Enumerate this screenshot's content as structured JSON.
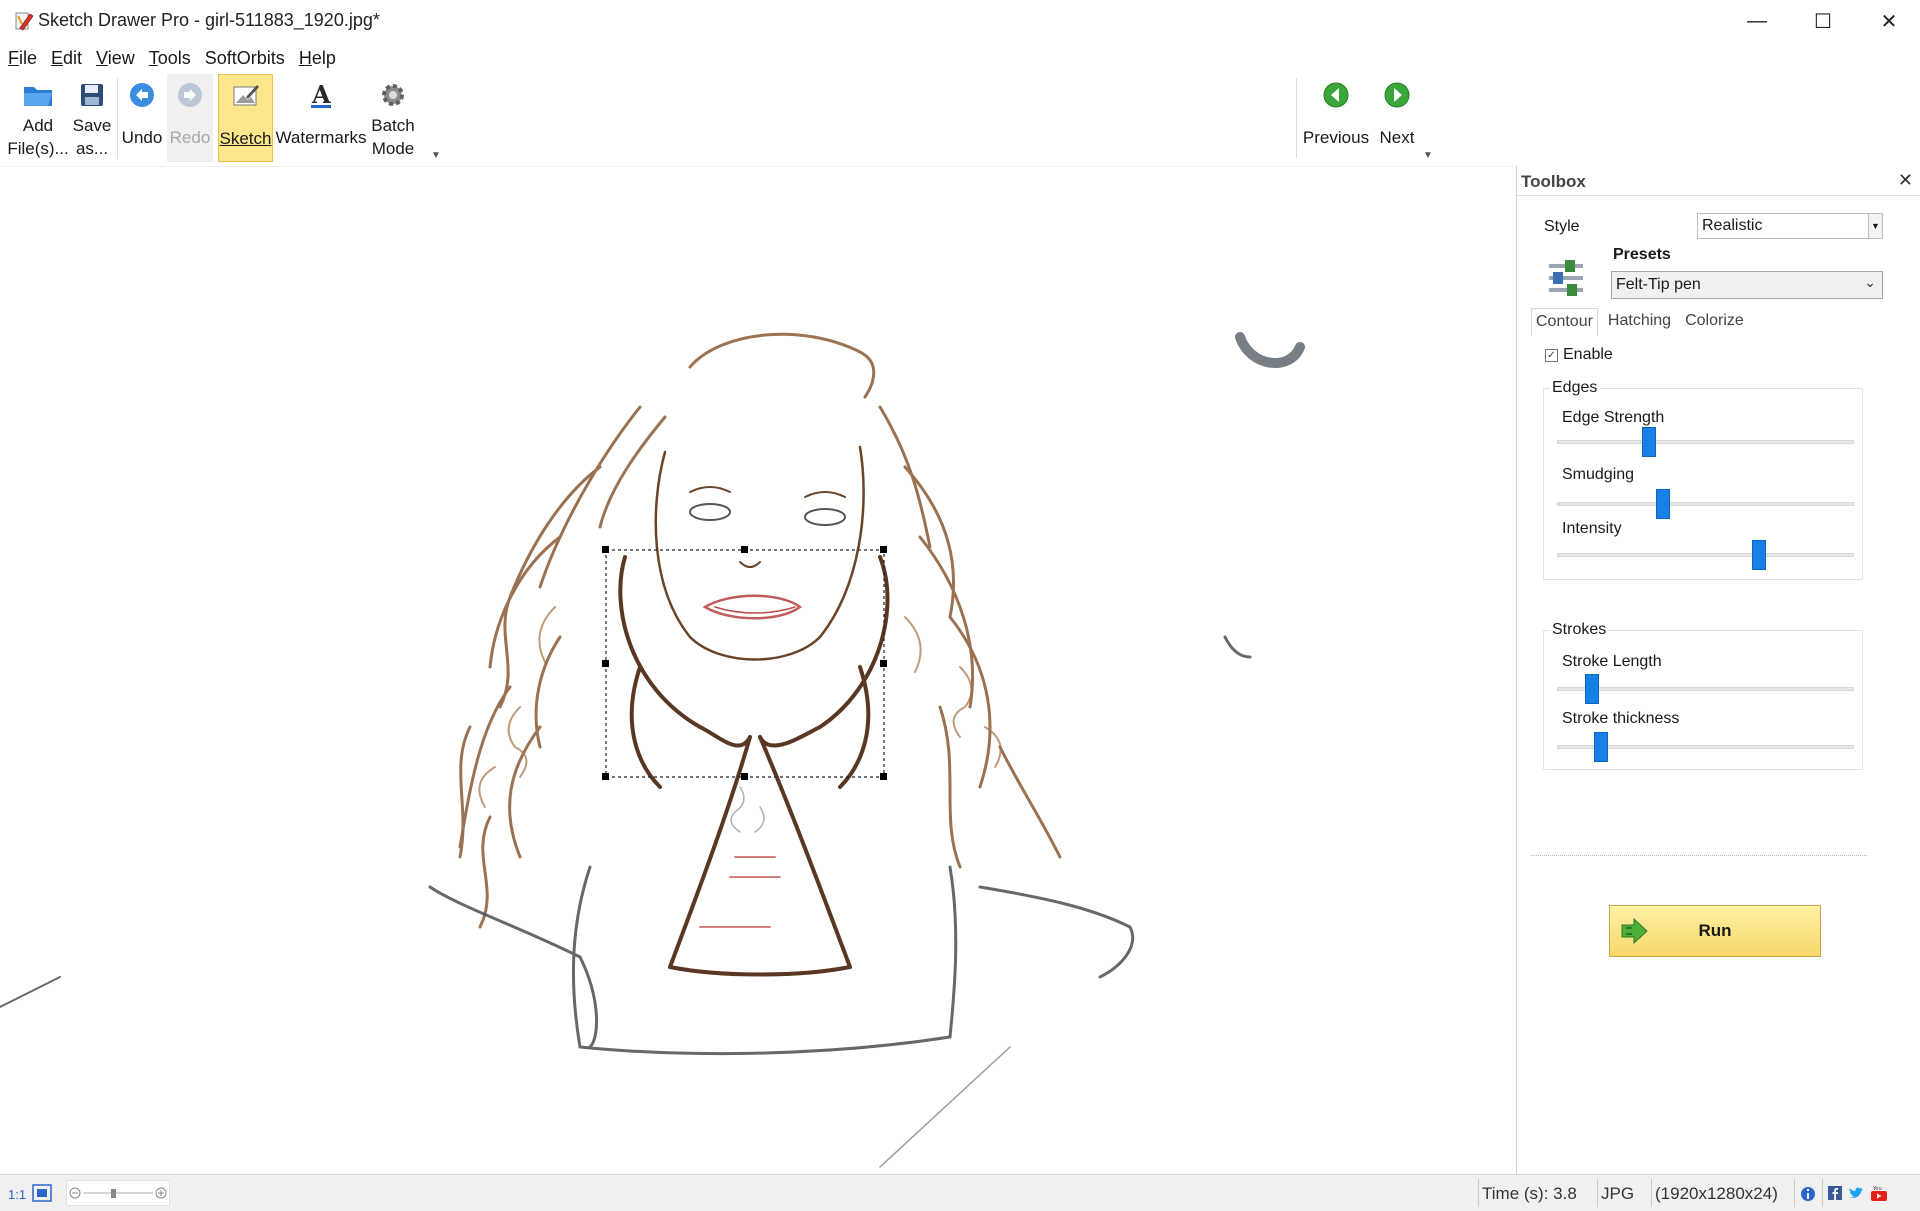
{
  "window": {
    "title": "Sketch Drawer Pro - girl-511883_1920.jpg*",
    "minimize_label": "—",
    "maximize_label": "☐",
    "close_label": "✕",
    "icon": "app-pencil-icon"
  },
  "menu": {
    "items": [
      {
        "u": "F",
        "rest": "ile"
      },
      {
        "u": "E",
        "rest": "dit"
      },
      {
        "u": "V",
        "rest": "iew"
      },
      {
        "u": "T",
        "rest": "ools"
      },
      {
        "u": "",
        "rest": "SoftOrbits"
      },
      {
        "u": "H",
        "rest": "elp"
      }
    ]
  },
  "toolbar": {
    "add_line1": "Add",
    "add_line2": "File(s)...",
    "save_line1": "Save",
    "save_line2": "as...",
    "undo": "Undo",
    "redo": "Redo",
    "sketch": "Sketch",
    "watermarks": "Watermarks",
    "batch_line1": "Batch",
    "batch_line2": "Mode",
    "previous": "Previous",
    "next": "Next",
    "accent_active": "#fde68c",
    "nav_green": "#3aa63a"
  },
  "toolbox": {
    "title": "Toolbox",
    "close_label": "✕",
    "style_label": "Style",
    "style_value": "Realistic",
    "presets_title": "Presets",
    "presets_value": "Felt-Tip pen",
    "tabs": [
      "Contour",
      "Hatching",
      "Colorize"
    ],
    "active_tab": "Contour",
    "enable_label": "Enable",
    "enable_checked": true,
    "edges_group": "Edges",
    "edge_strength_label": "Edge Strength",
    "edge_strength": 0.3,
    "smudging_label": "Smudging",
    "smudging": 0.35,
    "intensity_label": "Intensity",
    "intensity": 0.69,
    "strokes_group": "Strokes",
    "stroke_length_label": "Stroke Length",
    "stroke_length": 0.1,
    "stroke_thickness_label": "Stroke thickness",
    "stroke_thickness": 0.13,
    "run_label": "Run",
    "slider_color": "#1680e6"
  },
  "status": {
    "zoom_1to1": "1:1",
    "time": "Time (s): 3.8",
    "format": "JPG",
    "dimensions": "(1920x1280x24)"
  }
}
